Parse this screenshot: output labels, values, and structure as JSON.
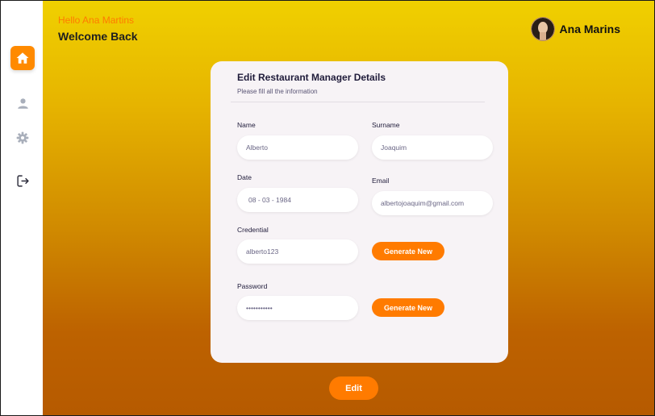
{
  "header": {
    "greeting": "Hello Ana Martins",
    "welcome": "Welcome Back",
    "profile_name": "Ana Marins"
  },
  "sidebar": {
    "items": [
      {
        "name": "home",
        "icon": "home-icon",
        "active": true
      },
      {
        "name": "profile",
        "icon": "user-icon",
        "active": false
      },
      {
        "name": "settings",
        "icon": "gear-icon",
        "active": false
      },
      {
        "name": "logout",
        "icon": "logout-icon",
        "active": false
      }
    ]
  },
  "form": {
    "title": "Edit Restaurant Manager Details",
    "subtitle": "Please fill all the information",
    "fields": {
      "name": {
        "label": "Name",
        "value": "Alberto"
      },
      "surname": {
        "label": "Surname",
        "value": "Joaquim"
      },
      "date": {
        "label": "Date",
        "value": "08 - 03 - 1984"
      },
      "email": {
        "label": "Email",
        "value": "albertojoaquim@gmail.com"
      },
      "credential": {
        "label": "Credential",
        "value": "alberto123"
      },
      "password": {
        "label": "Password",
        "value": "•••••••••••"
      }
    },
    "generate_label": "Generate New"
  },
  "actions": {
    "edit_label": "Edit"
  },
  "colors": {
    "accent": "#ff7b00",
    "gradient_top": "#f0d000",
    "gradient_bottom": "#b65a00",
    "card_bg": "#f7f3f6",
    "text_dark": "#1f1b3a"
  }
}
